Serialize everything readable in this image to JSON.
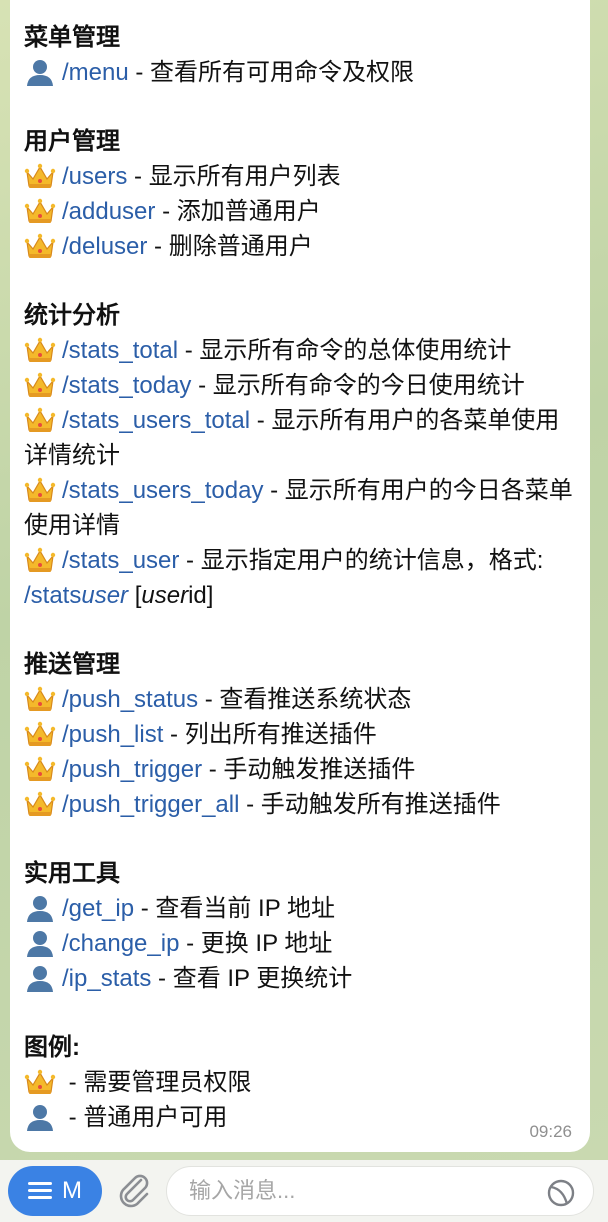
{
  "message": {
    "time": "09:26",
    "sections": [
      {
        "title": "菜单管理",
        "lines": [
          {
            "icon": "user",
            "cmd": "/menu",
            "desc": " - 查看所有可用命令及权限"
          }
        ]
      },
      {
        "title": "用户管理",
        "lines": [
          {
            "icon": "crown",
            "cmd": "/users",
            "desc": " - 显示所有用户列表"
          },
          {
            "icon": "crown",
            "cmd": "/adduser",
            "desc": " - 添加普通用户"
          },
          {
            "icon": "crown",
            "cmd": "/deluser",
            "desc": " - 删除普通用户"
          }
        ]
      },
      {
        "title": "统计分析",
        "lines": [
          {
            "icon": "crown",
            "cmd": "/stats_total",
            "desc": " - 显示所有命令的总体使用统计"
          },
          {
            "icon": "crown",
            "cmd": "/stats_today",
            "desc": " - 显示所有命令的今日使用统计"
          },
          {
            "icon": "crown",
            "cmd": "/stats_users_total",
            "desc": " - 显示所有用户的各菜单使用详情统计"
          },
          {
            "icon": "crown",
            "cmd": "/stats_users_today",
            "desc": " - 显示所有用户的今日各菜单使用详情"
          },
          {
            "icon": "crown",
            "cmd": "/stats_user",
            "desc": " - 显示指定用户的统计信息，格式: ",
            "extra_cmd_a": "/stats",
            "extra_cmd_b": "user",
            "extra_c": " [",
            "extra_d": "user",
            "extra_e": "id]"
          }
        ]
      },
      {
        "title": "推送管理",
        "lines": [
          {
            "icon": "crown",
            "cmd": "/push_status",
            "desc": " - 查看推送系统状态"
          },
          {
            "icon": "crown",
            "cmd": "/push_list",
            "desc": " - 列出所有推送插件"
          },
          {
            "icon": "crown",
            "cmd": "/push_trigger",
            "desc": " - 手动触发推送插件"
          },
          {
            "icon": "crown",
            "cmd": "/push_trigger_all",
            "desc": " - 手动触发所有推送插件"
          }
        ]
      },
      {
        "title": "实用工具",
        "lines": [
          {
            "icon": "user",
            "cmd": "/get_ip",
            "desc": " - 查看当前 IP 地址"
          },
          {
            "icon": "user",
            "cmd": "/change_ip",
            "desc": " - 更换 IP 地址"
          },
          {
            "icon": "user",
            "cmd": "/ip_stats",
            "desc": " - 查看 IP 更换统计"
          }
        ]
      },
      {
        "title": "图例:",
        "lines": [
          {
            "icon": "crown",
            "cmd": "",
            "desc": " - 需要管理员权限"
          },
          {
            "icon": "user",
            "cmd": "",
            "desc": " - 普通用户可用"
          }
        ]
      }
    ]
  },
  "input_bar": {
    "menu_label": "M",
    "placeholder": "输入消息..."
  },
  "colors": {
    "link": "#2b5ea8",
    "menu_button": "#3a82e4"
  }
}
